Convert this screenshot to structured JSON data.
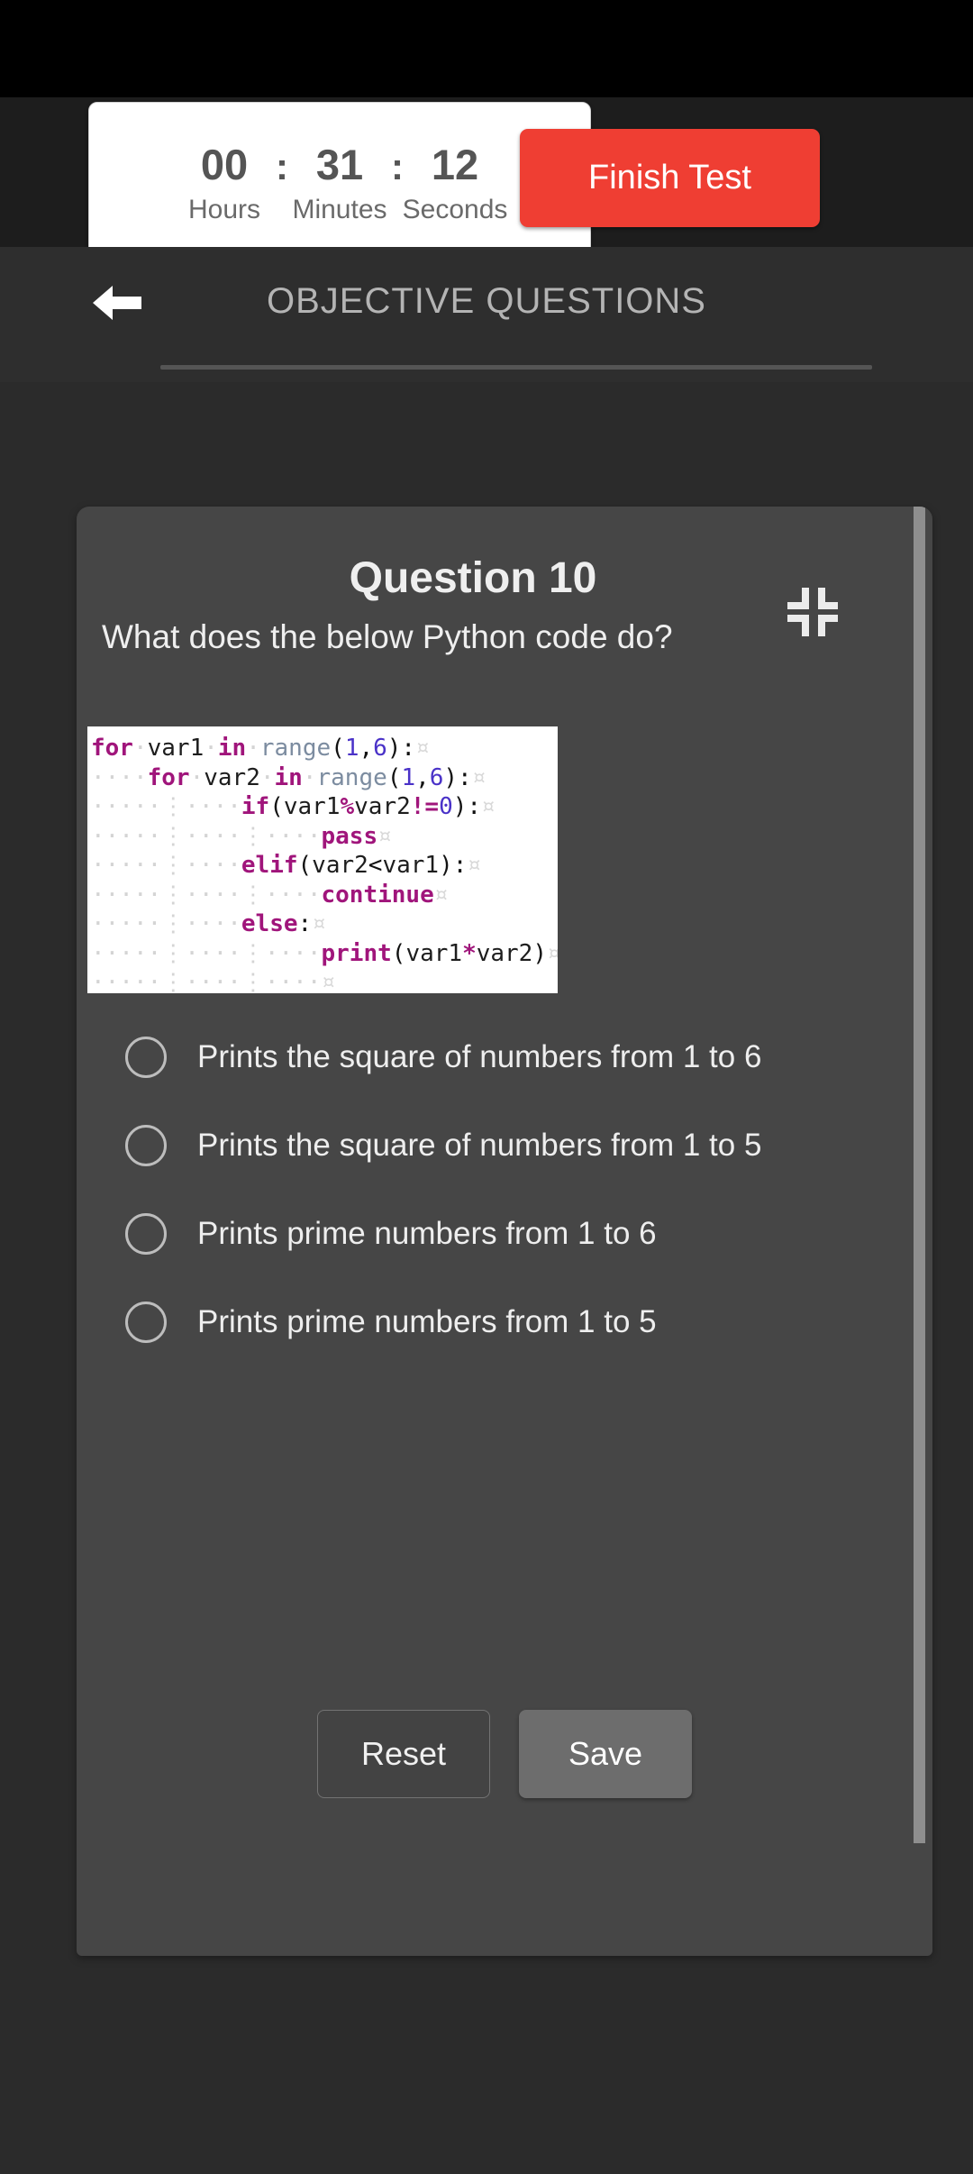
{
  "toolbar": {
    "timer": {
      "hours": "00",
      "minutes": "31",
      "seconds": "12",
      "colon": ":",
      "label_hours": "Hours",
      "label_minutes": "Minutes",
      "label_seconds": "Seconds"
    },
    "finish_label": "Finish Test",
    "finish_color": "#ef3e33"
  },
  "header": {
    "title": "OBJECTIVE QUESTIONS",
    "back_icon": "back-arrow-icon"
  },
  "question": {
    "number_label": "Question 10",
    "prompt": "What does the below Python code do?",
    "collapse_icon": "collapse-icon",
    "code": {
      "language": "python",
      "lines": [
        "for var1 in range(1,6):",
        "    for var2 in range(1,6):",
        "        if(var1%var2!=0):",
        "            pass",
        "        elif(var2<var1):",
        "            continue",
        "        else:",
        "            print(var1*var2)",
        "            "
      ]
    },
    "options": [
      {
        "id": "a",
        "label": "Prints the square of numbers from 1 to 6",
        "selected": false
      },
      {
        "id": "b",
        "label": "Prints the square of numbers from 1 to 5",
        "selected": false
      },
      {
        "id": "c",
        "label": "Prints prime numbers from 1 to 6",
        "selected": false
      },
      {
        "id": "d",
        "label": "Prints prime numbers from 1 to 5",
        "selected": false
      }
    ],
    "reset_label": "Reset",
    "save_label": "Save"
  }
}
